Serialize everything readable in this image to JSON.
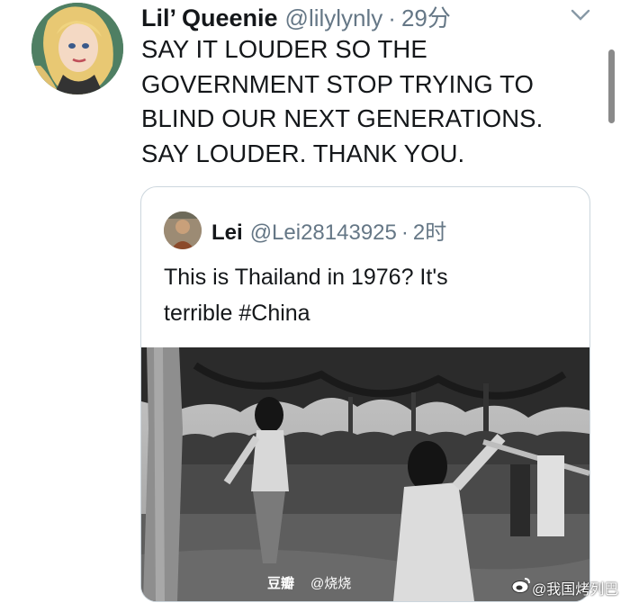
{
  "tweet": {
    "author_name": "Lil’ Queenie",
    "handle": "@lilylynly",
    "separator": "·",
    "time": "29分",
    "text_lines": [
      "SAY IT LOUDER SO THE",
      "GOVERNMENT STOP TRYING TO",
      "BLIND OUR NEXT GENERATIONS.",
      "SAY LOUDER. THANK YOU."
    ]
  },
  "quoted_tweet": {
    "author_name": "Lei",
    "handle": "@Lei28143925",
    "separator": "·",
    "time": "2时",
    "text_lines": [
      "This is Thailand in 1976?  It's",
      "terrible #China"
    ]
  },
  "watermarks": {
    "douban": "豆瓣",
    "douban_user": "@烧烧",
    "weibo": "@我国烤列巴"
  },
  "icons": {
    "menu": "chevron-down-icon",
    "weibo": "weibo-icon"
  },
  "colors": {
    "text": "#14171a",
    "secondary": "#657786",
    "border": "#ccd6dd"
  }
}
